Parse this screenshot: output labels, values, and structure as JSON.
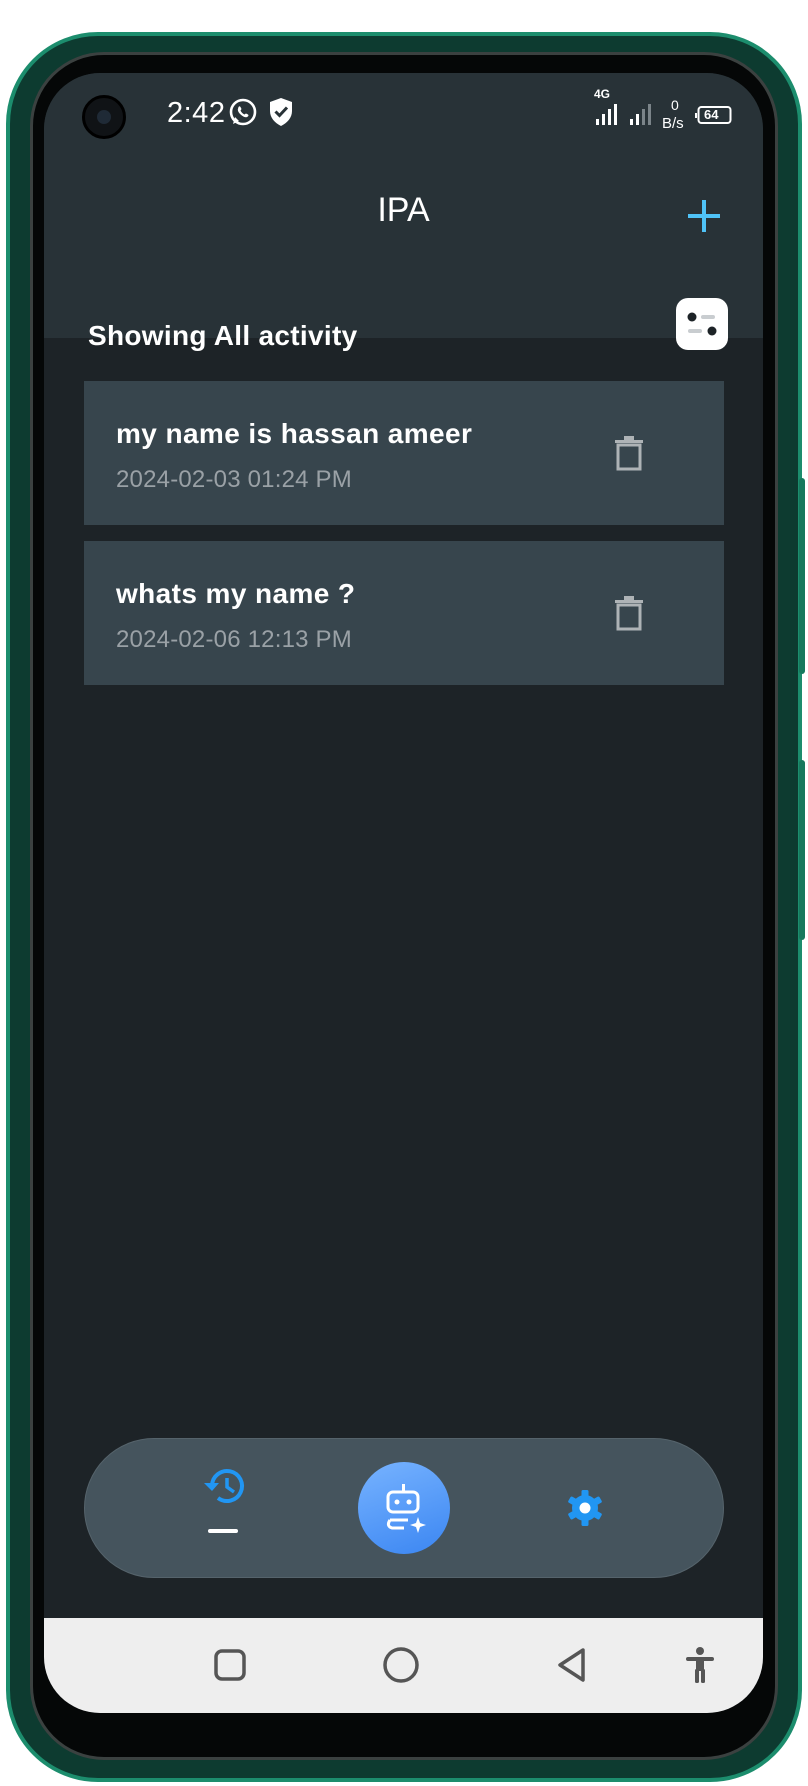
{
  "status_bar": {
    "time": "2:42",
    "network_label": "4G",
    "data_rate_value": "0",
    "data_rate_unit": "B/s",
    "battery": "64",
    "icons": [
      "whatsapp-icon",
      "shield-icon",
      "signal-icon",
      "battery-icon"
    ]
  },
  "app_bar": {
    "title": "IPA",
    "add_icon": "plus-icon",
    "accent_color": "#4fc3f7"
  },
  "filter": {
    "label": "Showing All activity",
    "icon": "filter-toggle-icon"
  },
  "activity_list": [
    {
      "title": "my name is hassan ameer",
      "date": "2024-02-03 01:24 PM",
      "action_icon": "delete-icon"
    },
    {
      "title": "whats my name ?",
      "date": "2024-02-06 12:13 PM",
      "action_icon": "delete-icon"
    }
  ],
  "bottom_nav": {
    "items": [
      {
        "icon": "history-icon",
        "active": true
      },
      {
        "icon": "bot-sparkle-icon",
        "active": false
      },
      {
        "icon": "gear-icon",
        "active": false
      }
    ],
    "accent_color": "#2196f3"
  },
  "system_nav": {
    "buttons": [
      "recents-icon",
      "home-icon",
      "back-icon",
      "accessibility-icon"
    ]
  }
}
